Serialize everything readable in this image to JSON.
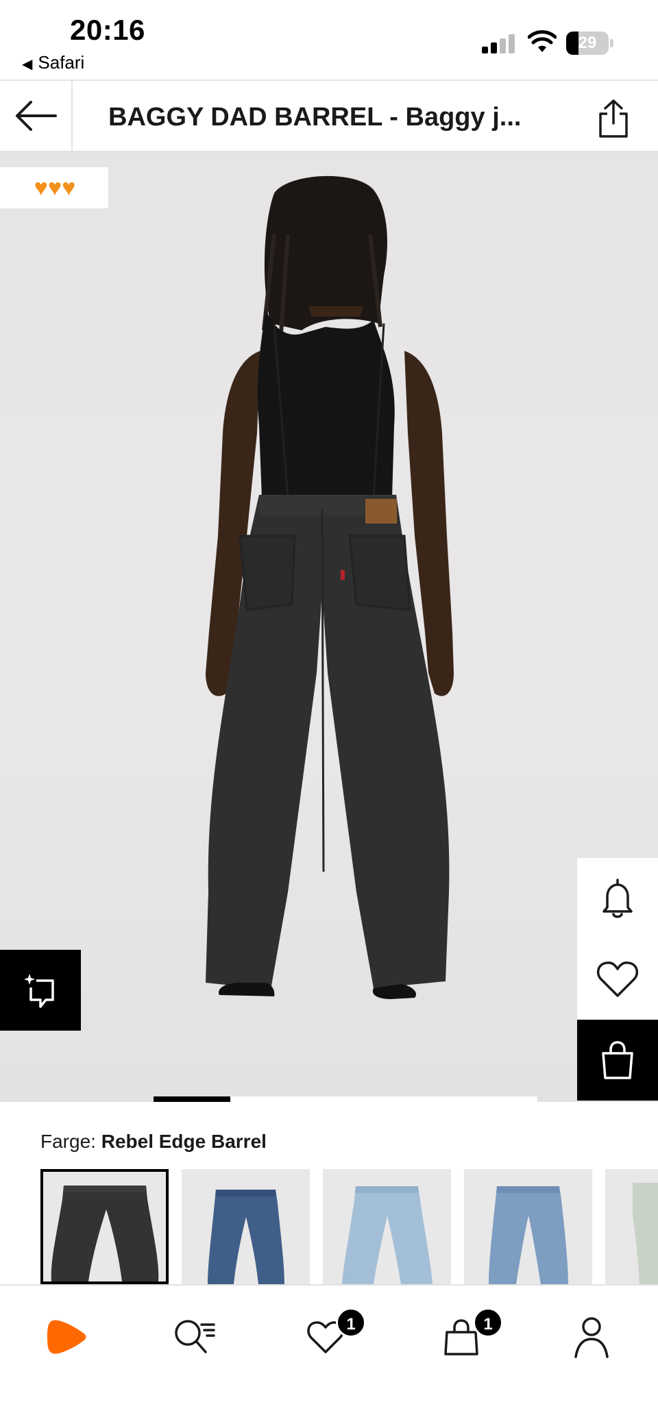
{
  "status_bar": {
    "time": "20:16",
    "back_app": "Safari",
    "battery": "29",
    "battery_level": 0.29
  },
  "header": {
    "title": "BAGGY DAD BARREL - Baggy j..."
  },
  "hero": {
    "badge_icons": [
      "orange-heart",
      "orange-heart",
      "orange-heart"
    ],
    "image_index": 0,
    "image_count": 5
  },
  "color": {
    "label": "Farge:",
    "value": "Rebel Edge Barrel",
    "swatches": [
      "Rebel Edge Barrel",
      "dark-blue",
      "light-blue",
      "mid-blue",
      "pale-green"
    ]
  },
  "nav": {
    "wishlist_count": "1",
    "cart_count": "1"
  },
  "colors": {
    "accent": "#ff6900",
    "badge_heart": "#f39019",
    "text": "#1a1a1a"
  }
}
